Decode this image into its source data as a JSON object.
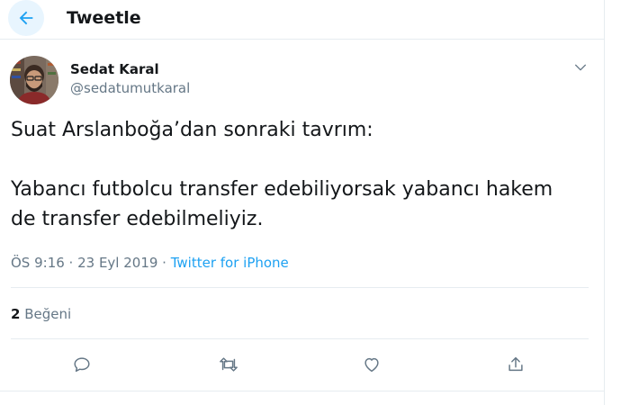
{
  "header": {
    "title": "Tweetle",
    "back_icon": "arrow-left-icon"
  },
  "tweet": {
    "author": {
      "display_name": "Sedat Karal",
      "handle": "@sedatumutkaral"
    },
    "text_lines": [
      "Suat Arslanboğa’dan sonraki tavrım:",
      "",
      "Yabancı futbolcu transfer edebiliyorsak yabancı hakem",
      "de transfer edebilmeliyiz."
    ],
    "timestamp": "ÖS 9:16 · 23 Eyl 2019",
    "separator": " · ",
    "source": "Twitter for iPhone",
    "likes_count": "2",
    "likes_label": " Beğeni"
  },
  "actions": [
    {
      "name": "reply",
      "icon": "reply-icon"
    },
    {
      "name": "retweet",
      "icon": "retweet-icon"
    },
    {
      "name": "like",
      "icon": "heart-icon"
    },
    {
      "name": "share",
      "icon": "share-icon"
    }
  ],
  "colors": {
    "accent": "#1da1f2",
    "text": "#14171a",
    "muted": "#657786",
    "border": "#e6ecf0"
  }
}
